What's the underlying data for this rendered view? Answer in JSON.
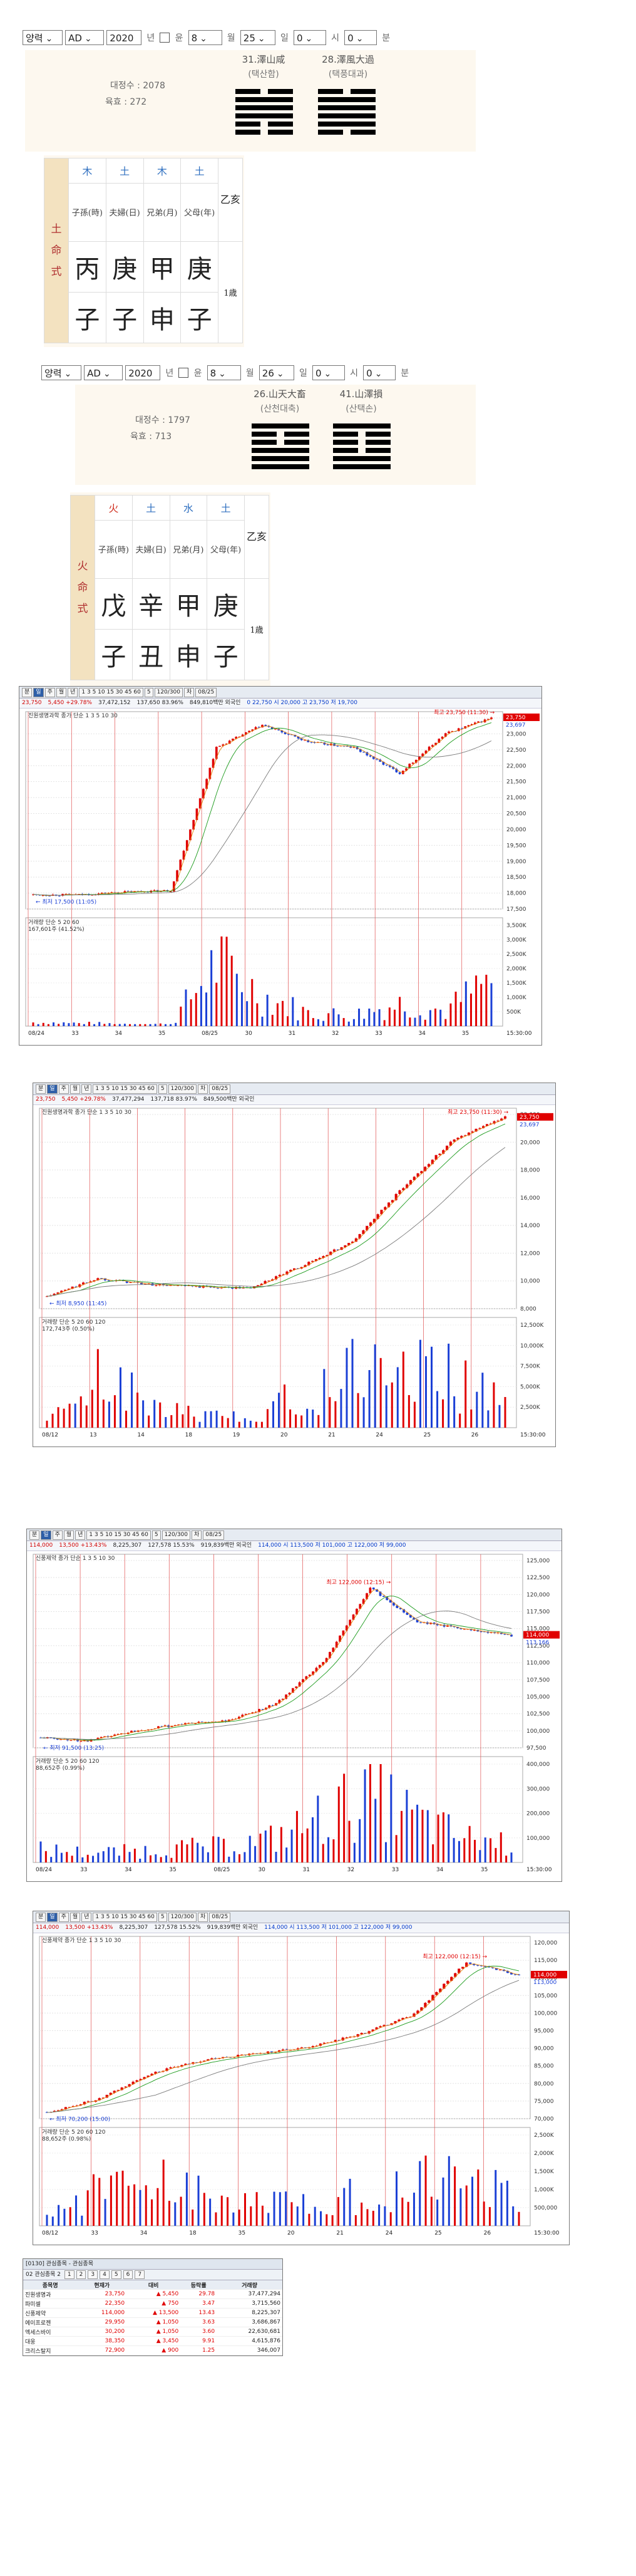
{
  "panel1": {
    "calendar": "양력",
    "era": "AD",
    "year": "2020",
    "year_unit": "년",
    "leap_label": "윤",
    "month": "8",
    "month_unit": "월",
    "day": "25",
    "day_unit": "일",
    "hour": "0",
    "hour_unit": "시",
    "minute": "0",
    "minute_unit": "분",
    "stat1": "대정수 : 2078",
    "stat2": "육효 : 272",
    "hex_left_name": "31.澤山咸",
    "hex_left_sub": "(택산함)",
    "hex_right_name": "28.澤風大過",
    "hex_right_sub": "(택풍대과)",
    "hex_left_lines": [
      "y",
      "g",
      "g",
      "g",
      "y",
      "y"
    ],
    "hex_right_lines": [
      "y",
      "g",
      "g",
      "g",
      "g",
      "y"
    ],
    "saju": {
      "side": "土 命 式",
      "elements": [
        "木",
        "土",
        "木",
        "土"
      ],
      "relations": [
        "子孫(時)",
        "夫婦(日)",
        "兄弟(月)",
        "父母(年)"
      ],
      "stems": [
        "丙",
        "庚",
        "甲",
        "庚"
      ],
      "branches": [
        "子",
        "子",
        "申",
        "子"
      ],
      "extra_top": "乙亥",
      "extra_bottom": "1歳"
    }
  },
  "panel2": {
    "calendar": "양력",
    "era": "AD",
    "year": "2020",
    "year_unit": "년",
    "leap_label": "윤",
    "month": "8",
    "month_unit": "월",
    "day": "26",
    "day_unit": "일",
    "hour": "0",
    "hour_unit": "시",
    "minute": "0",
    "minute_unit": "분",
    "stat1": "대정수 : 1797",
    "stat2": "육효 : 713",
    "hex_left_name": "26.山天大畜",
    "hex_left_sub": "(산천대축)",
    "hex_right_name": "41.山澤損",
    "hex_right_sub": "(산택손)",
    "hex_left_lines": [
      "g",
      "y",
      "y",
      "g",
      "g",
      "g"
    ],
    "hex_right_lines": [
      "g",
      "y",
      "y",
      "y",
      "g",
      "g"
    ],
    "saju": {
      "side": "火 命 式",
      "elements": [
        "火",
        "土",
        "水",
        "土"
      ],
      "relations": [
        "子孫(時)",
        "夫婦(日)",
        "兄弟(月)",
        "父母(年)"
      ],
      "stems": [
        "戊",
        "辛",
        "甲",
        "庚"
      ],
      "branches": [
        "子",
        "丑",
        "申",
        "子"
      ],
      "extra_top": "乙亥",
      "extra_bottom": "1歳"
    }
  },
  "charts": [
    {
      "toolbar": "분 | 일 | 주 | 월 | 년 | 1 3 5 10 15 30 45 60 | 5 | 120/300 | 차 | 08/25",
      "quote": {
        "price": "23,750",
        "change": "5,450 +29.78%",
        "volume": "37,472,152",
        "amount": "137,650 83.96%",
        "mcap": "849,810백만 외국인",
        "extra": "0 22,750 시 20,000 고 23,750 저 19,700"
      },
      "name": "진원생명과학",
      "ma_legend": "종가 단순 1 3 5 10 30",
      "high_note": "최고 23,750 (11:30)",
      "low_note": "최저 17,500 (11:05)",
      "ma_values": [
        "23,750",
        "23,697"
      ],
      "vol_legend": "거래량 단순 5 20 60",
      "vol_note": "167,601주 (41.52%)",
      "y_ticks": [
        "23,500",
        "23,000",
        "22,500",
        "22,000",
        "21,500",
        "21,000",
        "20,500",
        "20,000",
        "19,500",
        "19,000",
        "18,500",
        "18,000",
        "17,500"
      ],
      "vol_ticks": [
        "3,500K",
        "3,000K",
        "2,500K",
        "2,000K",
        "1,500K",
        "1,000K",
        "500K"
      ],
      "x_labels": [
        "08/24",
        "33",
        "34",
        "35",
        "08/25",
        "30",
        "31",
        "32",
        "33",
        "34",
        "35"
      ],
      "time_label": "15:30:00",
      "chart_data": {
        "type": "line",
        "title": "진원생명과학",
        "x": [
          "08/24",
          "33",
          "34",
          "35",
          "08/25",
          "30",
          "31",
          "32",
          "33",
          "34",
          "35"
        ],
        "series": [
          {
            "name": "종가",
            "values": [
              17500,
              17500,
              17600,
              17650,
              22700,
              23500,
              22900,
              22700,
              21800,
              23200,
              23750
            ]
          }
        ],
        "volume": [
          200,
          150,
          120,
          100,
          3400,
          1600,
          700,
          600,
          1200,
          800,
          2500
        ],
        "ylim": [
          17000,
          23750
        ],
        "vol_max": 3500
      }
    },
    {
      "toolbar": "분 | 일 | 주 | 월 | 년 | 1 3 5 10 15 30 45 60 | 5 | 120/300 | 차 | 08/25",
      "quote": {
        "price": "23,750",
        "change": "5,450 +29.78%",
        "volume": "37,477,294",
        "amount": "137,718 83.97%",
        "mcap": "849,500백만 외국인",
        "extra": ""
      },
      "name": "진원생명과학",
      "ma_legend": "종가 단순 1 3 5 10 30",
      "high_note": "최고 23,750 (11:30)",
      "low_note": "최저 8,950 (11:45)",
      "ma_values": [
        "23,750",
        "23,697"
      ],
      "vol_legend": "거래량 단순 5 20 60 120",
      "vol_note": "172,743주 (0.50%)",
      "y_ticks": [
        "22,000",
        "20,000",
        "18,000",
        "16,000",
        "14,000",
        "12,000",
        "10,000",
        "8,000"
      ],
      "vol_ticks": [
        "12,500K",
        "10,000K",
        "7,500K",
        "5,000K",
        "2,500K"
      ],
      "x_labels": [
        "08/12",
        "13",
        "14",
        "18",
        "19",
        "20",
        "21",
        "24",
        "25",
        "26"
      ],
      "time_label": "15:30:00",
      "chart_data": {
        "type": "line",
        "title": "진원생명과학",
        "x": [
          "08/12",
          "13",
          "14",
          "18",
          "19",
          "20",
          "21",
          "24",
          "25",
          "26"
        ],
        "series": [
          {
            "name": "종가",
            "values": [
              9000,
              10500,
              10000,
              9800,
              9700,
              11500,
              13500,
              18000,
              22000,
              23750
            ]
          }
        ],
        "volume": [
          1000,
          9000,
          5000,
          2000,
          2500,
          6000,
          11000,
          12500,
          9000,
          4000
        ],
        "ylim": [
          8000,
          24000
        ],
        "vol_max": 12500
      }
    },
    {
      "toolbar": "분 | 일 | 주 | 월 | 년 | 1 3 5 10 15 30 45 60 | 5 | 120/300 | 차 | 08/25",
      "quote": {
        "price": "114,000",
        "change": "13,500 +13.43%",
        "volume": "8,225,307",
        "amount": "127,578 15.53%",
        "mcap": "919,839백만 외국인",
        "extra": "114,000 시 113,500 저 101,000 고 122,000 저 99,000"
      },
      "name": "신풍제약",
      "ma_legend": "종가 단순 1 3 5 10 30",
      "high_note": "최고 122,000 (12:15)",
      "low_note": "최저 91,500 (13:25)",
      "ma_values": [
        "114,000",
        "113,166"
      ],
      "vol_legend": "거래량 단순 5 20 60 120",
      "vol_note": "88,652주 (0.99%)",
      "y_ticks": [
        "125,000",
        "122,500",
        "120,000",
        "117,500",
        "115,000",
        "112,500",
        "110,000",
        "107,500",
        "105,000",
        "102,500",
        "100,000",
        "97,500"
      ],
      "vol_ticks": [
        "400,000",
        "300,000",
        "200,000",
        "100,000"
      ],
      "x_labels": [
        "08/24",
        "33",
        "34",
        "35",
        "08/25",
        "30",
        "31",
        "32",
        "33",
        "34",
        "35"
      ],
      "time_label": "15:30:00",
      "chart_data": {
        "type": "line",
        "title": "신풍제약",
        "x": [
          "08/24",
          "33",
          "34",
          "35",
          "08/25",
          "30",
          "31",
          "32",
          "33",
          "34",
          "35"
        ],
        "series": [
          {
            "name": "종가",
            "values": [
              99000,
              98500,
              100000,
              101000,
              101500,
              104000,
              110000,
              121000,
              116000,
              115000,
              114000
            ]
          }
        ],
        "volume": [
          80,
          60,
          70,
          90,
          100,
          150,
          280,
          420,
          260,
          150,
          120
        ],
        "ylim": [
          97500,
          125000
        ],
        "vol_max": 400
      }
    },
    {
      "toolbar": "분 | 일 | 주 | 월 | 년 | 1 3 5 10 15 30 45 60 | 5 | 120/300 | 차 | 08/25",
      "quote": {
        "price": "114,000",
        "change": "13,500 +13.43%",
        "volume": "8,225,307",
        "amount": "127,578 15.52%",
        "mcap": "919,839백만 외국인",
        "extra": "114,000 시 113,500 저 101,000 고 122,000 저 99,000"
      },
      "name": "신풍제약",
      "ma_legend": "종가 단순 1 3 5 10 30",
      "high_note": "최고 122,000 (12:15)",
      "low_note": "최저 70,200 (15:00)",
      "ma_values": [
        "114,000",
        "113,000"
      ],
      "vol_legend": "거래량 단순 5 20 60 120",
      "vol_note": "88,652주 (0.98%)",
      "y_ticks": [
        "120,000",
        "115,000",
        "110,000",
        "105,000",
        "100,000",
        "95,000",
        "90,000",
        "85,000",
        "80,000",
        "75,000",
        "70,000"
      ],
      "vol_ticks": [
        "2,500K",
        "2,000K",
        "1,500K",
        "1,000K",
        "500,000"
      ],
      "x_labels": [
        "08/12",
        "33",
        "34",
        "18",
        "35",
        "20",
        "21",
        "24",
        "25",
        "26"
      ],
      "time_label": "15:30:00",
      "chart_data": {
        "type": "line",
        "title": "신풍제약",
        "x": [
          "08/12",
          "33",
          "34",
          "18",
          "35",
          "20",
          "21",
          "24",
          "25",
          "26"
        ],
        "series": [
          {
            "name": "종가",
            "values": [
              72000,
              76000,
              84000,
              88000,
              90000,
              92000,
              96000,
              102000,
              118000,
              114000
            ]
          }
        ],
        "volume": [
          800,
          1500,
          1800,
          1200,
          900,
          1000,
          1400,
          1800,
          2300,
          1000
        ],
        "ylim": [
          70000,
          124000
        ],
        "vol_max": 2500
      }
    }
  ],
  "watchlist": {
    "title": "[0130] 관심종목 - 관심종목",
    "group": "02 관심종목 2",
    "tabs": [
      "1",
      "2",
      "3",
      "4",
      "5",
      "6",
      "7"
    ],
    "headers": [
      "종목명",
      "현재가",
      "대비",
      "등락률",
      "거래량"
    ],
    "rows": [
      {
        "name": "진원생명과",
        "price": "23,750",
        "diff": "5,450",
        "rate": "29.78",
        "vol": "37,477,294",
        "dir": "up"
      },
      {
        "name": "파미셀",
        "price": "22,350",
        "diff": "750",
        "rate": "3.47",
        "vol": "3,715,560",
        "dir": "up"
      },
      {
        "name": "신풍제약",
        "price": "114,000",
        "diff": "13,500",
        "rate": "13.43",
        "vol": "8,225,307",
        "dir": "up"
      },
      {
        "name": "에이프로젠",
        "price": "29,950",
        "diff": "1,050",
        "rate": "3.63",
        "vol": "3,686,867",
        "dir": "up"
      },
      {
        "name": "엑세스바이",
        "price": "30,200",
        "diff": "1,050",
        "rate": "3.60",
        "vol": "22,630,681",
        "dir": "up"
      },
      {
        "name": "대웅",
        "price": "38,350",
        "diff": "3,450",
        "rate": "9.91",
        "vol": "4,615,876",
        "dir": "up"
      },
      {
        "name": "크리스탈지",
        "price": "72,900",
        "diff": "900",
        "rate": "1.25",
        "vol": "346,007",
        "dir": "up"
      }
    ]
  },
  "colors": {
    "up": "#e00000",
    "down": "#1a3fd6",
    "accent": "#2e5fa8"
  }
}
